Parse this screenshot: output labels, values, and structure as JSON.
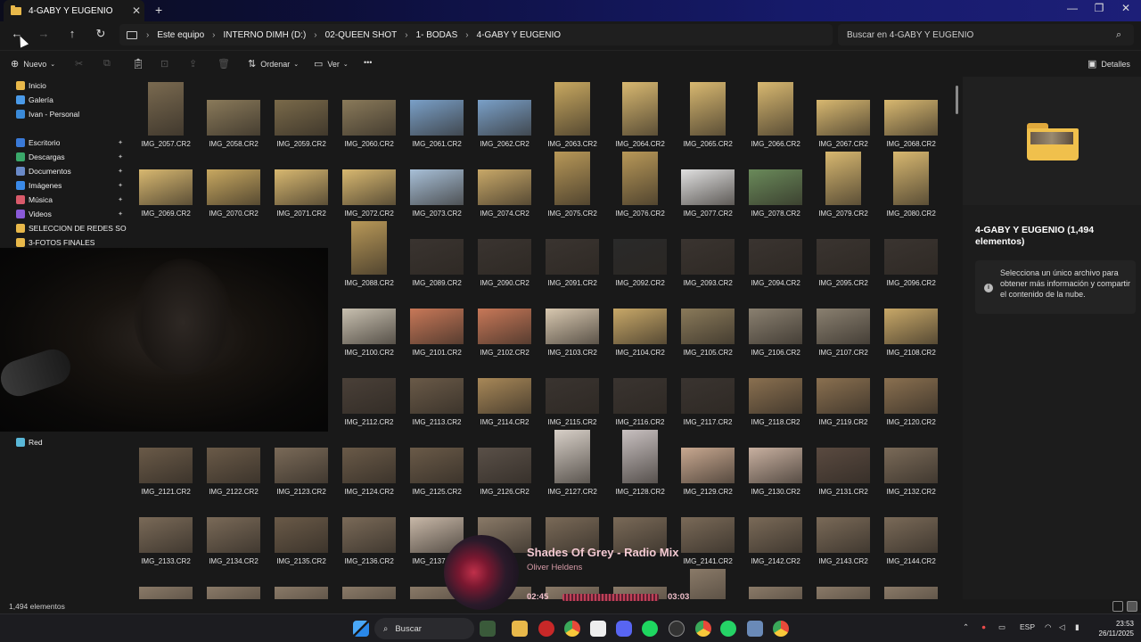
{
  "tab": {
    "title": "4-GABY Y EUGENIO",
    "close": "✕",
    "new": "+"
  },
  "window": {
    "min": "—",
    "max": "❐",
    "close": "✕"
  },
  "nav": {
    "back": "←",
    "forward": "→",
    "up": "↑",
    "refresh": "↻"
  },
  "breadcrumb": [
    "Este equipo",
    "INTERNO DIMH (D:)",
    "02-QUEEN SHOT",
    "1- BODAS",
    "4-GABY Y EUGENIO"
  ],
  "search": {
    "placeholder": "Buscar en 4-GABY Y EUGENIO"
  },
  "commandbar": {
    "new": "Nuevo",
    "sort": "Ordenar",
    "view": "Ver",
    "more": "•••",
    "details": "Detalles"
  },
  "sidebar": {
    "items": [
      {
        "label": "Inicio",
        "icon": "home-icon",
        "color": "#e8b84a",
        "pinned": false
      },
      {
        "label": "Galería",
        "icon": "gallery-icon",
        "color": "#4a9ae8",
        "pinned": false
      },
      {
        "label": "Ivan - Personal",
        "icon": "cloud-icon",
        "color": "#3a8ad8",
        "pinned": false
      },
      {
        "label": "Escritorio",
        "icon": "desktop-icon",
        "color": "#3a7ad8",
        "pinned": true
      },
      {
        "label": "Descargas",
        "icon": "download-icon",
        "color": "#3aa86a",
        "pinned": true
      },
      {
        "label": "Documentos",
        "icon": "documents-icon",
        "color": "#6a8ac8",
        "pinned": true
      },
      {
        "label": "Imágenes",
        "icon": "pictures-icon",
        "color": "#3a8ae8",
        "pinned": true
      },
      {
        "label": "Música",
        "icon": "music-icon",
        "color": "#d85a6a",
        "pinned": true
      },
      {
        "label": "Videos",
        "icon": "videos-icon",
        "color": "#8a5ad8",
        "pinned": true
      },
      {
        "label": "SELECCION DE REDES SOCIALES",
        "icon": "folder-icon",
        "color": "#e8b84a",
        "pinned": false
      },
      {
        "label": "3-FOTOS FINALES",
        "icon": "folder-icon",
        "color": "#e8b84a",
        "pinned": false
      },
      {
        "label": "Red",
        "icon": "network-icon",
        "color": "#5ab8d8",
        "pinned": false
      }
    ]
  },
  "files": [
    {
      "name": "IMG_2057.CR2",
      "o": "p",
      "c": "#7a6a50"
    },
    {
      "name": "IMG_2058.CR2",
      "o": "l",
      "c": "#8a7a5a"
    },
    {
      "name": "IMG_2059.CR2",
      "o": "l",
      "c": "#7a6a4a"
    },
    {
      "name": "IMG_2060.CR2",
      "o": "l",
      "c": "#8a7a5a"
    },
    {
      "name": "IMG_2061.CR2",
      "o": "l",
      "c": "#7aa0c8"
    },
    {
      "name": "IMG_2062.CR2",
      "o": "l",
      "c": "#7aa0c8"
    },
    {
      "name": "IMG_2063.CR2",
      "o": "p",
      "c": "#c8a860"
    },
    {
      "name": "IMG_2064.CR2",
      "o": "p",
      "c": "#d8b870"
    },
    {
      "name": "IMG_2065.CR2",
      "o": "p",
      "c": "#d8b870"
    },
    {
      "name": "IMG_2066.CR2",
      "o": "p",
      "c": "#d8b870"
    },
    {
      "name": "IMG_2067.CR2",
      "o": "l",
      "c": "#d8b870"
    },
    {
      "name": "IMG_2068.CR2",
      "o": "l",
      "c": "#d8b870"
    },
    {
      "name": "IMG_2069.CR2",
      "o": "l",
      "c": "#d8b870"
    },
    {
      "name": "IMG_2070.CR2",
      "o": "l",
      "c": "#c8a860"
    },
    {
      "name": "IMG_2071.CR2",
      "o": "l",
      "c": "#d8b870"
    },
    {
      "name": "IMG_2072.CR2",
      "o": "l",
      "c": "#d8b870"
    },
    {
      "name": "IMG_2073.CR2",
      "o": "l",
      "c": "#a8c0d8"
    },
    {
      "name": "IMG_2074.CR2",
      "o": "l",
      "c": "#c8a868"
    },
    {
      "name": "IMG_2075.CR2",
      "o": "p",
      "c": "#b89858"
    },
    {
      "name": "IMG_2076.CR2",
      "o": "p",
      "c": "#b89858"
    },
    {
      "name": "IMG_2077.CR2",
      "o": "l",
      "c": "#e0e0e0"
    },
    {
      "name": "IMG_2078.CR2",
      "o": "l",
      "c": "#6a8a5a"
    },
    {
      "name": "IMG_2079.CR2",
      "o": "p",
      "c": "#d8b870"
    },
    {
      "name": "IMG_2080.CR2",
      "o": "p",
      "c": "#d8b870"
    },
    {
      "name": "",
      "o": "x",
      "c": ""
    },
    {
      "name": "",
      "o": "x",
      "c": ""
    },
    {
      "name": "",
      "o": "x",
      "c": ""
    },
    {
      "name": "IMG_2088.CR2",
      "o": "p",
      "c": "#b89858"
    },
    {
      "name": "IMG_2089.CR2",
      "o": "l",
      "c": "#3a3430"
    },
    {
      "name": "IMG_2090.CR2",
      "o": "l",
      "c": "#3a3430"
    },
    {
      "name": "IMG_2091.CR2",
      "o": "l",
      "c": "#3a3430"
    },
    {
      "name": "IMG_2092.CR2",
      "o": "l",
      "c": "#2a2a2a"
    },
    {
      "name": "IMG_2093.CR2",
      "o": "l",
      "c": "#3a3430"
    },
    {
      "name": "IMG_2094.CR2",
      "o": "l",
      "c": "#3a3430"
    },
    {
      "name": "IMG_2095.CR2",
      "o": "l",
      "c": "#3a3430"
    },
    {
      "name": "IMG_2096.CR2",
      "o": "l",
      "c": "#3a3430"
    },
    {
      "name": "",
      "o": "x",
      "c": ""
    },
    {
      "name": "",
      "o": "x",
      "c": ""
    },
    {
      "name": "",
      "o": "x",
      "c": ""
    },
    {
      "name": "IMG_2100.CR2",
      "o": "l",
      "c": "#c8c0b0"
    },
    {
      "name": "IMG_2101.CR2",
      "o": "l",
      "c": "#c87858"
    },
    {
      "name": "IMG_2102.CR2",
      "o": "l",
      "c": "#c87858"
    },
    {
      "name": "IMG_2103.CR2",
      "o": "l",
      "c": "#d8c8b0"
    },
    {
      "name": "IMG_2104.CR2",
      "o": "l",
      "c": "#c8a868"
    },
    {
      "name": "IMG_2105.CR2",
      "o": "l",
      "c": "#8a7a5a"
    },
    {
      "name": "IMG_2106.CR2",
      "o": "l",
      "c": "#8a8070"
    },
    {
      "name": "IMG_2107.CR2",
      "o": "l",
      "c": "#8a8070"
    },
    {
      "name": "IMG_2108.CR2",
      "o": "l",
      "c": "#c8a868"
    },
    {
      "name": "",
      "o": "x",
      "c": ""
    },
    {
      "name": "",
      "o": "x",
      "c": ""
    },
    {
      "name": "",
      "o": "x",
      "c": ""
    },
    {
      "name": "IMG_2112.CR2",
      "o": "l",
      "c": "#4a4038"
    },
    {
      "name": "IMG_2113.CR2",
      "o": "l",
      "c": "#6a5a48"
    },
    {
      "name": "IMG_2114.CR2",
      "o": "l",
      "c": "#a88858"
    },
    {
      "name": "IMG_2115.CR2",
      "o": "l",
      "c": "#3a3430"
    },
    {
      "name": "IMG_2116.CR2",
      "o": "l",
      "c": "#3a3430"
    },
    {
      "name": "IMG_2117.CR2",
      "o": "l",
      "c": "#3a3430"
    },
    {
      "name": "IMG_2118.CR2",
      "o": "l",
      "c": "#8a7050"
    },
    {
      "name": "IMG_2119.CR2",
      "o": "l",
      "c": "#8a7050"
    },
    {
      "name": "IMG_2120.CR2",
      "o": "l",
      "c": "#8a7050"
    },
    {
      "name": "IMG_2121.CR2",
      "o": "l",
      "c": "#6a5a48"
    },
    {
      "name": "IMG_2122.CR2",
      "o": "l",
      "c": "#6a5a48"
    },
    {
      "name": "IMG_2123.CR2",
      "o": "l",
      "c": "#7a6a58"
    },
    {
      "name": "IMG_2124.CR2",
      "o": "l",
      "c": "#6a5a48"
    },
    {
      "name": "IMG_2125.CR2",
      "o": "l",
      "c": "#6a5a48"
    },
    {
      "name": "IMG_2126.CR2",
      "o": "l",
      "c": "#5a5048"
    },
    {
      "name": "IMG_2127.CR2",
      "o": "p",
      "c": "#d8d0c8"
    },
    {
      "name": "IMG_2128.CR2",
      "o": "p",
      "c": "#c8c0c0"
    },
    {
      "name": "IMG_2129.CR2",
      "o": "l",
      "c": "#c8a890"
    },
    {
      "name": "IMG_2130.CR2",
      "o": "l",
      "c": "#c8b0a0"
    },
    {
      "name": "IMG_2131.CR2",
      "o": "l",
      "c": "#5a4a40"
    },
    {
      "name": "IMG_2132.CR2",
      "o": "l",
      "c": "#7a6a58"
    },
    {
      "name": "IMG_2133.CR2",
      "o": "l",
      "c": "#7a6a58"
    },
    {
      "name": "IMG_2134.CR2",
      "o": "l",
      "c": "#7a6a58"
    },
    {
      "name": "IMG_2135.CR2",
      "o": "l",
      "c": "#6a5a48"
    },
    {
      "name": "IMG_2136.CR2",
      "o": "l",
      "c": "#7a6a58"
    },
    {
      "name": "IMG_2137.CR2",
      "o": "l",
      "c": "#c8b8a8"
    },
    {
      "name": "",
      "o": "l",
      "c": "#8a7a68"
    },
    {
      "name": "",
      "o": "l",
      "c": "#7a6a58"
    },
    {
      "name": "",
      "o": "l",
      "c": "#7a6a58"
    },
    {
      "name": "IMG_2141.CR2",
      "o": "l",
      "c": "#7a6a58"
    },
    {
      "name": "IMG_2142.CR2",
      "o": "l",
      "c": "#7a6a58"
    },
    {
      "name": "IMG_2143.CR2",
      "o": "l",
      "c": "#7a6a58"
    },
    {
      "name": "IMG_2144.CR2",
      "o": "l",
      "c": "#7a6a58"
    },
    {
      "name": "",
      "o": "l",
      "c": "#8a7a68"
    },
    {
      "name": "",
      "o": "l",
      "c": "#8a7a68"
    },
    {
      "name": "",
      "o": "l",
      "c": "#8a7a68"
    },
    {
      "name": "",
      "o": "l",
      "c": "#8a7a68"
    },
    {
      "name": "",
      "o": "l",
      "c": "#8a7a68"
    },
    {
      "name": "",
      "o": "l",
      "c": "#8a7a68"
    },
    {
      "name": "",
      "o": "l",
      "c": "#8a7a68"
    },
    {
      "name": "",
      "o": "l",
      "c": "#8a7a68"
    },
    {
      "name": "",
      "o": "p",
      "c": "#8a7a68"
    },
    {
      "name": "",
      "o": "l",
      "c": "#8a7a68"
    },
    {
      "name": "",
      "o": "l",
      "c": "#8a7a68"
    },
    {
      "name": "",
      "o": "l",
      "c": "#8a7a68"
    }
  ],
  "details": {
    "title": "4-GABY Y EUGENIO (1,494 elementos)",
    "info": "Selecciona un único archivo para obtener más información y compartir el contenido de la nube.",
    "info_icon": "i"
  },
  "status": {
    "count": "1,494 elementos"
  },
  "media": {
    "title": "Shades Of Grey - Radio Mix",
    "artist": "Oliver Heldens",
    "elapsed": "02:45",
    "total": "03:03",
    "progress": 0.9
  },
  "taskbar": {
    "search": "Buscar",
    "lang": "ESP",
    "time": "23:53",
    "date": "26/11/2025"
  }
}
